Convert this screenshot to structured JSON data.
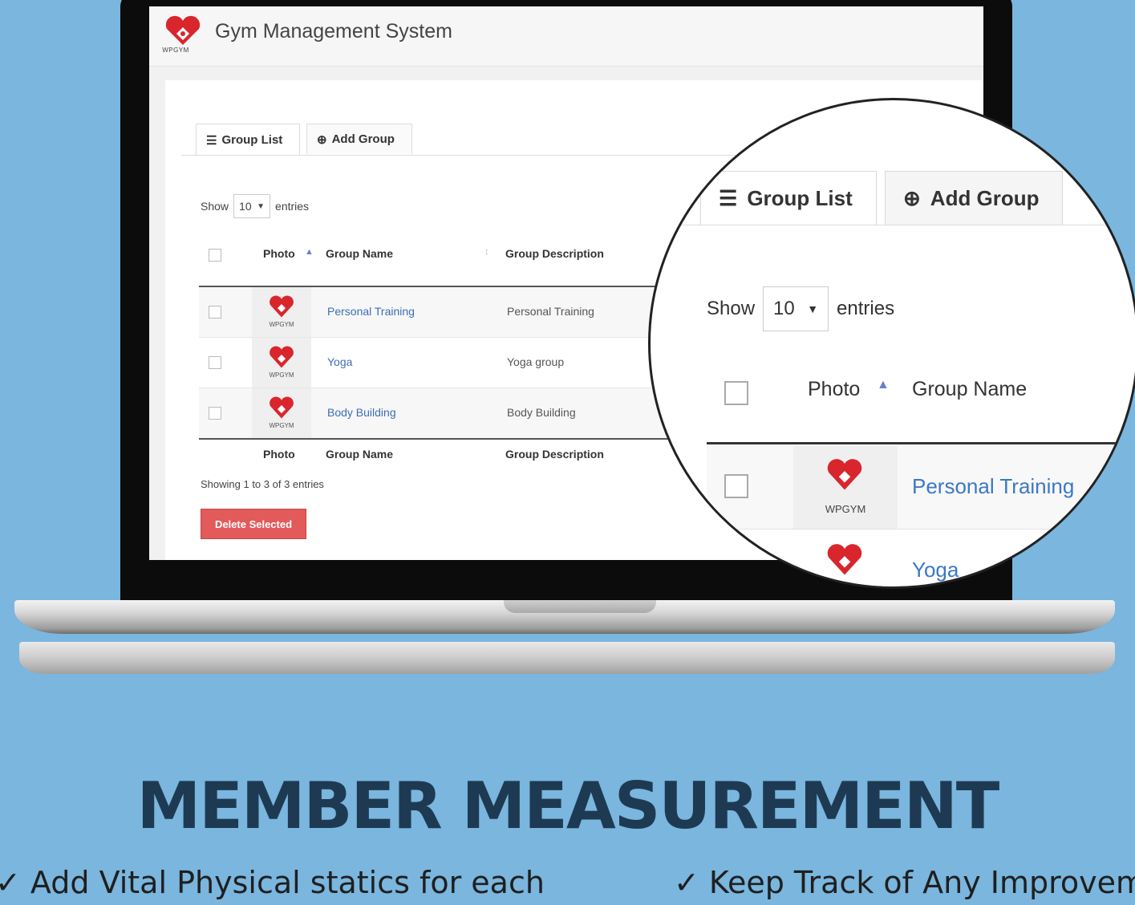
{
  "app": {
    "title": "Gym Management System",
    "logo_text": "WPGYM"
  },
  "tabs": {
    "group_list": "Group List",
    "add_group": "Add Group"
  },
  "entries": {
    "show_label": "Show",
    "value": "10",
    "entries_label": "entries"
  },
  "table": {
    "headers": {
      "photo": "Photo",
      "group_name": "Group Name",
      "group_description": "Group Description"
    },
    "rows": [
      {
        "name": "Personal Training",
        "description": "Personal Training"
      },
      {
        "name": "Yoga",
        "description": "Yoga group"
      },
      {
        "name": "Body Building",
        "description": "Body Building"
      }
    ],
    "footer": {
      "photo": "Photo",
      "group_name": "Group Name",
      "group_description": "Group Description"
    },
    "info": "Showing 1 to 3 of 3 entries"
  },
  "actions": {
    "delete_selected": "Delete Selected"
  },
  "headline": "MEMBER MEASUREMENT",
  "features": [
    "✓ Add Vital Physical statics for each",
    "✓ Keep Track of Any Improvem"
  ],
  "colors": {
    "background": "#7ab6de",
    "brand_red": "#d9262d",
    "link": "#3b6fb6",
    "delete_button": "#e35a5a",
    "headline": "#1e3a53"
  }
}
